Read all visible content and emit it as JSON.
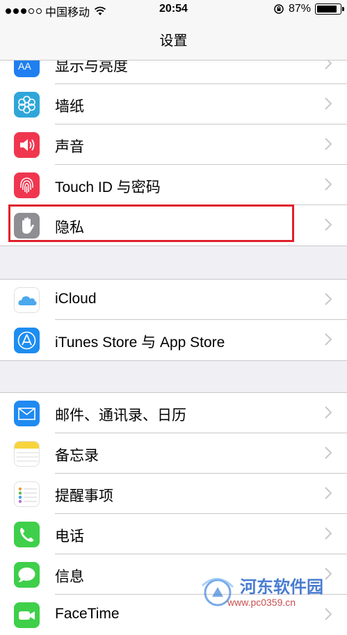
{
  "status_bar": {
    "carrier": "中国移动",
    "time": "20:54",
    "battery": "87%"
  },
  "nav": {
    "title": "设置"
  },
  "groups": [
    {
      "rows": [
        {
          "label": "显示与亮度",
          "icon": "display-brightness-icon"
        },
        {
          "label": "墙纸",
          "icon": "wallpaper-icon"
        },
        {
          "label": "声音",
          "icon": "sound-icon"
        },
        {
          "label": "Touch ID 与密码",
          "icon": "fingerprint-icon"
        },
        {
          "label": "隐私",
          "icon": "privacy-hand-icon"
        }
      ]
    },
    {
      "rows": [
        {
          "label": "iCloud",
          "icon": "icloud-icon"
        },
        {
          "label": "iTunes Store 与 App Store",
          "icon": "app-store-icon"
        }
      ]
    },
    {
      "rows": [
        {
          "label": "邮件、通讯录、日历",
          "icon": "mail-icon"
        },
        {
          "label": "备忘录",
          "icon": "notes-icon"
        },
        {
          "label": "提醒事项",
          "icon": "reminders-icon"
        },
        {
          "label": "电话",
          "icon": "phone-icon"
        },
        {
          "label": "信息",
          "icon": "messages-icon"
        },
        {
          "label": "FaceTime",
          "icon": "facetime-icon"
        }
      ]
    }
  ],
  "watermark": {
    "title": "河东软件园",
    "url": "www.pc0359.cn"
  },
  "colors": {
    "highlight": "#e0202a",
    "background": "#efeff4"
  }
}
